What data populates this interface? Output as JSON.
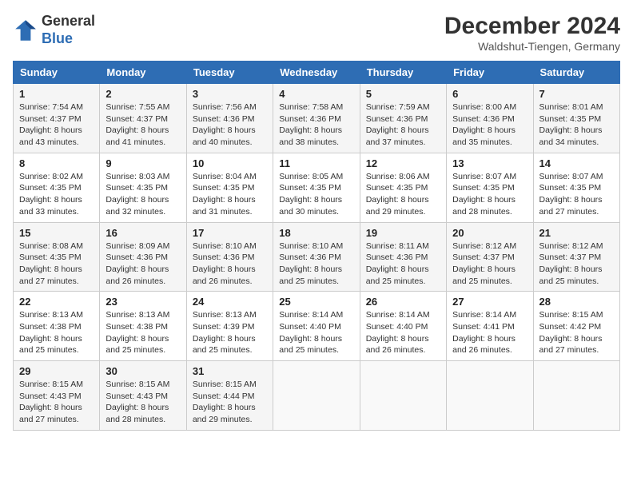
{
  "logo": {
    "general": "General",
    "blue": "Blue"
  },
  "header": {
    "month": "December 2024",
    "location": "Waldshut-Tiengen, Germany"
  },
  "columns": [
    "Sunday",
    "Monday",
    "Tuesday",
    "Wednesday",
    "Thursday",
    "Friday",
    "Saturday"
  ],
  "weeks": [
    [
      {
        "day": "1",
        "sunrise": "Sunrise: 7:54 AM",
        "sunset": "Sunset: 4:37 PM",
        "daylight": "Daylight: 8 hours and 43 minutes."
      },
      {
        "day": "2",
        "sunrise": "Sunrise: 7:55 AM",
        "sunset": "Sunset: 4:37 PM",
        "daylight": "Daylight: 8 hours and 41 minutes."
      },
      {
        "day": "3",
        "sunrise": "Sunrise: 7:56 AM",
        "sunset": "Sunset: 4:36 PM",
        "daylight": "Daylight: 8 hours and 40 minutes."
      },
      {
        "day": "4",
        "sunrise": "Sunrise: 7:58 AM",
        "sunset": "Sunset: 4:36 PM",
        "daylight": "Daylight: 8 hours and 38 minutes."
      },
      {
        "day": "5",
        "sunrise": "Sunrise: 7:59 AM",
        "sunset": "Sunset: 4:36 PM",
        "daylight": "Daylight: 8 hours and 37 minutes."
      },
      {
        "day": "6",
        "sunrise": "Sunrise: 8:00 AM",
        "sunset": "Sunset: 4:36 PM",
        "daylight": "Daylight: 8 hours and 35 minutes."
      },
      {
        "day": "7",
        "sunrise": "Sunrise: 8:01 AM",
        "sunset": "Sunset: 4:35 PM",
        "daylight": "Daylight: 8 hours and 34 minutes."
      }
    ],
    [
      {
        "day": "8",
        "sunrise": "Sunrise: 8:02 AM",
        "sunset": "Sunset: 4:35 PM",
        "daylight": "Daylight: 8 hours and 33 minutes."
      },
      {
        "day": "9",
        "sunrise": "Sunrise: 8:03 AM",
        "sunset": "Sunset: 4:35 PM",
        "daylight": "Daylight: 8 hours and 32 minutes."
      },
      {
        "day": "10",
        "sunrise": "Sunrise: 8:04 AM",
        "sunset": "Sunset: 4:35 PM",
        "daylight": "Daylight: 8 hours and 31 minutes."
      },
      {
        "day": "11",
        "sunrise": "Sunrise: 8:05 AM",
        "sunset": "Sunset: 4:35 PM",
        "daylight": "Daylight: 8 hours and 30 minutes."
      },
      {
        "day": "12",
        "sunrise": "Sunrise: 8:06 AM",
        "sunset": "Sunset: 4:35 PM",
        "daylight": "Daylight: 8 hours and 29 minutes."
      },
      {
        "day": "13",
        "sunrise": "Sunrise: 8:07 AM",
        "sunset": "Sunset: 4:35 PM",
        "daylight": "Daylight: 8 hours and 28 minutes."
      },
      {
        "day": "14",
        "sunrise": "Sunrise: 8:07 AM",
        "sunset": "Sunset: 4:35 PM",
        "daylight": "Daylight: 8 hours and 27 minutes."
      }
    ],
    [
      {
        "day": "15",
        "sunrise": "Sunrise: 8:08 AM",
        "sunset": "Sunset: 4:35 PM",
        "daylight": "Daylight: 8 hours and 27 minutes."
      },
      {
        "day": "16",
        "sunrise": "Sunrise: 8:09 AM",
        "sunset": "Sunset: 4:36 PM",
        "daylight": "Daylight: 8 hours and 26 minutes."
      },
      {
        "day": "17",
        "sunrise": "Sunrise: 8:10 AM",
        "sunset": "Sunset: 4:36 PM",
        "daylight": "Daylight: 8 hours and 26 minutes."
      },
      {
        "day": "18",
        "sunrise": "Sunrise: 8:10 AM",
        "sunset": "Sunset: 4:36 PM",
        "daylight": "Daylight: 8 hours and 25 minutes."
      },
      {
        "day": "19",
        "sunrise": "Sunrise: 8:11 AM",
        "sunset": "Sunset: 4:36 PM",
        "daylight": "Daylight: 8 hours and 25 minutes."
      },
      {
        "day": "20",
        "sunrise": "Sunrise: 8:12 AM",
        "sunset": "Sunset: 4:37 PM",
        "daylight": "Daylight: 8 hours and 25 minutes."
      },
      {
        "day": "21",
        "sunrise": "Sunrise: 8:12 AM",
        "sunset": "Sunset: 4:37 PM",
        "daylight": "Daylight: 8 hours and 25 minutes."
      }
    ],
    [
      {
        "day": "22",
        "sunrise": "Sunrise: 8:13 AM",
        "sunset": "Sunset: 4:38 PM",
        "daylight": "Daylight: 8 hours and 25 minutes."
      },
      {
        "day": "23",
        "sunrise": "Sunrise: 8:13 AM",
        "sunset": "Sunset: 4:38 PM",
        "daylight": "Daylight: 8 hours and 25 minutes."
      },
      {
        "day": "24",
        "sunrise": "Sunrise: 8:13 AM",
        "sunset": "Sunset: 4:39 PM",
        "daylight": "Daylight: 8 hours and 25 minutes."
      },
      {
        "day": "25",
        "sunrise": "Sunrise: 8:14 AM",
        "sunset": "Sunset: 4:40 PM",
        "daylight": "Daylight: 8 hours and 25 minutes."
      },
      {
        "day": "26",
        "sunrise": "Sunrise: 8:14 AM",
        "sunset": "Sunset: 4:40 PM",
        "daylight": "Daylight: 8 hours and 26 minutes."
      },
      {
        "day": "27",
        "sunrise": "Sunrise: 8:14 AM",
        "sunset": "Sunset: 4:41 PM",
        "daylight": "Daylight: 8 hours and 26 minutes."
      },
      {
        "day": "28",
        "sunrise": "Sunrise: 8:15 AM",
        "sunset": "Sunset: 4:42 PM",
        "daylight": "Daylight: 8 hours and 27 minutes."
      }
    ],
    [
      {
        "day": "29",
        "sunrise": "Sunrise: 8:15 AM",
        "sunset": "Sunset: 4:43 PM",
        "daylight": "Daylight: 8 hours and 27 minutes."
      },
      {
        "day": "30",
        "sunrise": "Sunrise: 8:15 AM",
        "sunset": "Sunset: 4:43 PM",
        "daylight": "Daylight: 8 hours and 28 minutes."
      },
      {
        "day": "31",
        "sunrise": "Sunrise: 8:15 AM",
        "sunset": "Sunset: 4:44 PM",
        "daylight": "Daylight: 8 hours and 29 minutes."
      },
      null,
      null,
      null,
      null
    ]
  ]
}
